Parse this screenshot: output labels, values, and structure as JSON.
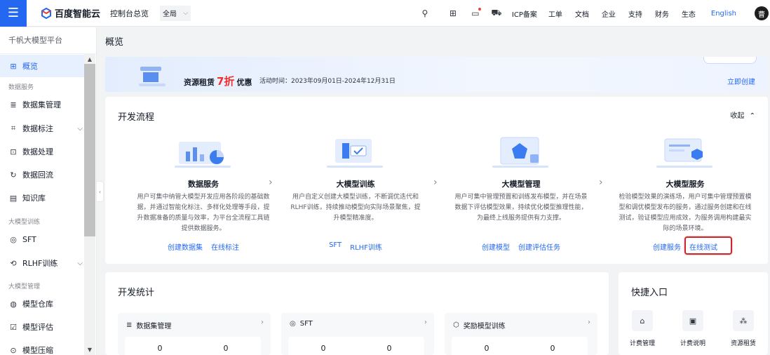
{
  "header": {
    "menu_icon": "hamburger-icon",
    "brand": "百度智能云",
    "console": "控制台总览",
    "region": "全局",
    "nav": [
      "ICP备案",
      "工单",
      "文档",
      "企业",
      "支持",
      "财务",
      "生态"
    ],
    "language": "English",
    "avatar": "曹"
  },
  "sidebar": {
    "title": "千帆大模型平台",
    "items": [
      {
        "label": "概览",
        "icon": "grid-icon"
      },
      {
        "label": "数据集管理",
        "icon": "database-icon"
      },
      {
        "label": "数据标注",
        "icon": "label-icon"
      },
      {
        "label": "数据处理",
        "icon": "process-icon"
      },
      {
        "label": "数据回流",
        "icon": "reflow-icon"
      },
      {
        "label": "知识库",
        "icon": "book-icon"
      },
      {
        "label": "SFT",
        "icon": "target-icon"
      },
      {
        "label": "RLHF训练",
        "icon": "training-icon"
      },
      {
        "label": "模型仓库",
        "icon": "warehouse-icon"
      },
      {
        "label": "模型评估",
        "icon": "evaluate-icon"
      },
      {
        "label": "模型压缩",
        "icon": "compress-icon"
      }
    ],
    "groups": [
      "数据服务",
      "大模型训练",
      "大模型管理"
    ]
  },
  "main": {
    "title": "概览",
    "banner": {
      "prefix": "资源租赁",
      "discount": "7折",
      "suffix": "优惠",
      "date": "活动时间：2023年09月01日-2024年12月31日",
      "cta": "立即创建"
    },
    "flow": {
      "title": "开发流程",
      "collapse": "收起",
      "steps": [
        {
          "title": "数据服务",
          "desc": "用户可集中纳管大模型开发应用各阶段的基础数据，并通过智能化标注、多样化处理等手段，提升数据准备的质量与效率，为平台全流程工具链提供数据服务。",
          "links": [
            "创建数据集",
            "在线标注"
          ]
        },
        {
          "title": "大模型训练",
          "desc": "用户自定义创建大模型训练，不断调优迭代和RLHF训练，持续推动模型向实际场景聚焦，提升模型精准度。",
          "links": [
            "SFT",
            "RLHF训练"
          ]
        },
        {
          "title": "大模型管理",
          "desc": "用户可集中管理预置和训练发布模型，并在场景数据下评估模型效果，持续优化模型推理性能，为最终上线服务提供有力支撑。",
          "links": [
            "创建模型",
            "创建评估任务"
          ]
        },
        {
          "title": "大模型服务",
          "desc": "检验模型效果的演练场，用户可集中管理预置模型和调优模型发布的服务，通过服务创建和在线测试，验证模型应用成效，为服务调用构建最实际的场景环境。",
          "links": [
            "创建服务",
            "在线测试"
          ]
        }
      ]
    },
    "stats": {
      "title": "开发统计",
      "boxes": [
        {
          "label": "数据集管理",
          "value": "0",
          "value2": "0",
          "icon": "database-icon"
        },
        {
          "label": "SFT",
          "value": "0",
          "value2": "0",
          "icon": "target-icon"
        },
        {
          "label": "奖励模型训练",
          "value": "0",
          "value2": "0",
          "icon": "reward-icon"
        }
      ]
    },
    "quick": {
      "title": "快捷入口",
      "items": [
        {
          "label": "计费管理",
          "icon": "home-icon"
        },
        {
          "label": "计费说明",
          "icon": "doc-icon"
        },
        {
          "label": "资源租赁",
          "icon": "cluster-icon"
        }
      ]
    }
  },
  "colors": {
    "accent": "#2468f2",
    "highlight": "#c8282d",
    "discount": "#f0302e"
  }
}
